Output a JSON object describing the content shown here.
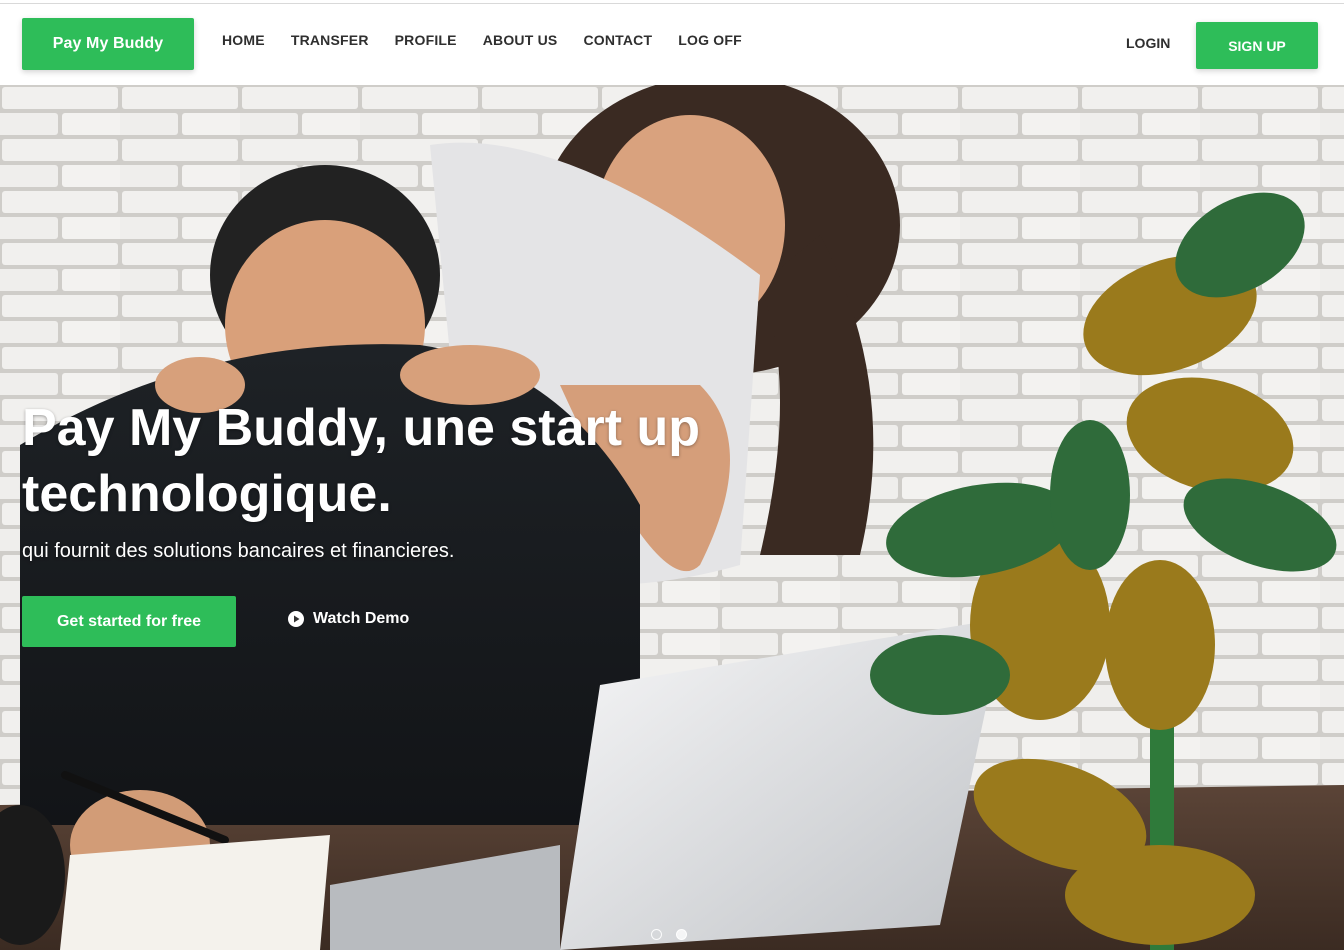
{
  "navbar": {
    "brand": "Pay My Buddy",
    "items": [
      {
        "label": "HOME"
      },
      {
        "label": "TRANSFER"
      },
      {
        "label": "PROFILE"
      },
      {
        "label": "ABOUT US"
      },
      {
        "label": "CONTACT"
      },
      {
        "label": "LOG OFF"
      }
    ],
    "login": "LOGIN",
    "signup": "SIGN UP"
  },
  "hero": {
    "title": "Pay My Buddy, une start up technologique.",
    "subtitle": "qui fournit des solutions bancaires et financieres.",
    "cta": "Get started for free",
    "demo": "Watch Demo",
    "demo_icon": "play-circle-icon",
    "slides": [
      {
        "active": true
      },
      {
        "active": false
      }
    ]
  },
  "colors": {
    "accent": "#2ebd59",
    "nav_text": "#2f2f2f"
  }
}
